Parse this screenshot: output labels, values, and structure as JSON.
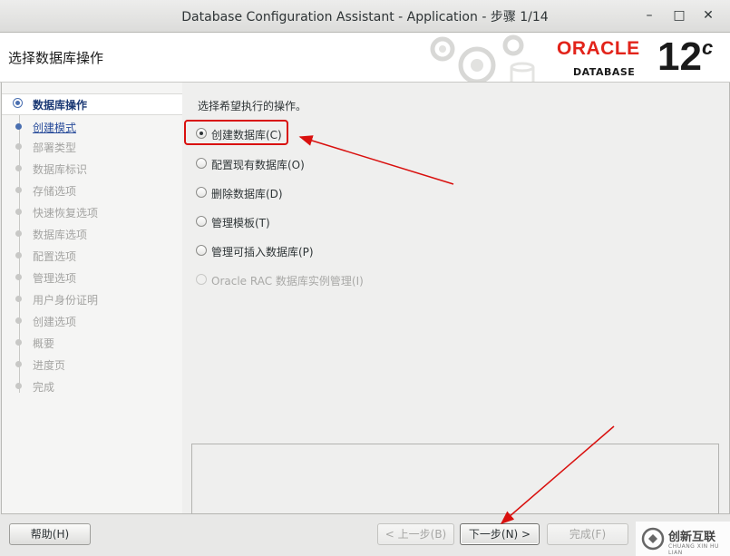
{
  "window": {
    "title": "Database Configuration Assistant - Application - 步骤 1/14",
    "minimize_glyph": "–",
    "maximize_glyph": "□",
    "close_glyph": "✕"
  },
  "banner": {
    "heading": "选择数据库操作",
    "brand": "ORACLE",
    "brand_sub": "DATABASE",
    "version": "12",
    "version_sup": "c",
    "brand_color": "#e2231a"
  },
  "nav": {
    "steps": [
      {
        "label": "数据库操作",
        "state": "current"
      },
      {
        "label": "创建模式",
        "state": "link"
      },
      {
        "label": "部署类型",
        "state": "disabled"
      },
      {
        "label": "数据库标识",
        "state": "disabled"
      },
      {
        "label": "存储选项",
        "state": "disabled"
      },
      {
        "label": "快速恢复选项",
        "state": "disabled"
      },
      {
        "label": "数据库选项",
        "state": "disabled"
      },
      {
        "label": "配置选项",
        "state": "disabled"
      },
      {
        "label": "管理选项",
        "state": "disabled"
      },
      {
        "label": "用户身份证明",
        "state": "disabled"
      },
      {
        "label": "创建选项",
        "state": "disabled"
      },
      {
        "label": "概要",
        "state": "disabled"
      },
      {
        "label": "进度页",
        "state": "disabled"
      },
      {
        "label": "完成",
        "state": "disabled"
      }
    ]
  },
  "content": {
    "prompt": "选择希望执行的操作。",
    "options": [
      {
        "label": "创建数据库(C)",
        "checked": true,
        "disabled": false
      },
      {
        "label": "配置现有数据库(O)",
        "checked": false,
        "disabled": false
      },
      {
        "label": "删除数据库(D)",
        "checked": false,
        "disabled": false
      },
      {
        "label": "管理模板(T)",
        "checked": false,
        "disabled": false
      },
      {
        "label": "管理可插入数据库(P)",
        "checked": false,
        "disabled": false
      },
      {
        "label": "Oracle RAC 数据库实例管理(I)",
        "checked": false,
        "disabled": true
      }
    ],
    "annotation_color": "#d9100e"
  },
  "buttons": {
    "help": "帮助(H)",
    "back": "< 上一步(B)",
    "next": "下一步(N) >",
    "finish": "完成(F)"
  },
  "watermark": {
    "text": "创新互联",
    "sub": "CHUANG XIN HU LIAN"
  }
}
